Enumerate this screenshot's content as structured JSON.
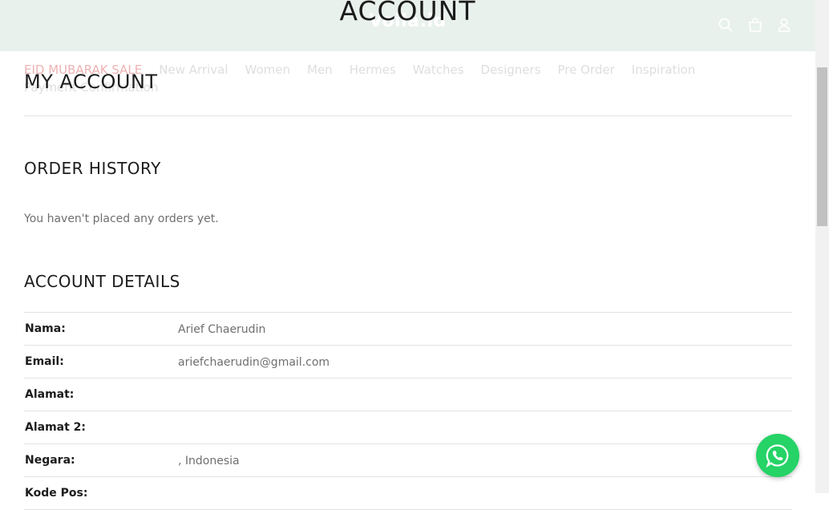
{
  "header": {
    "logo": "Voila.id",
    "page_heading": "ACCOUNT",
    "icons": [
      "search-icon",
      "cart-icon",
      "user-icon"
    ]
  },
  "nav": {
    "items": [
      "EID MUBARAK SALE",
      "New Arrival",
      "Women",
      "Men",
      "Hermes",
      "Watches",
      "Designers",
      "Pre Order",
      "Inspiration"
    ],
    "items_row2": [
      "Payment Confirmation"
    ]
  },
  "main": {
    "title": "MY ACCOUNT",
    "order_history": {
      "heading": "ORDER HISTORY",
      "empty_text": "You haven't placed any orders yet."
    },
    "account_details": {
      "heading": "ACCOUNT DETAILS",
      "rows": [
        {
          "label": "Nama:",
          "value": "Arief Chaerudin"
        },
        {
          "label": "Email:",
          "value": "ariefchaerudin@gmail.com"
        },
        {
          "label": "Alamat:",
          "value": ""
        },
        {
          "label": "Alamat 2:",
          "value": ""
        },
        {
          "label": "Negara:",
          "value": ", Indonesia"
        },
        {
          "label": "Kode Pos:",
          "value": ""
        }
      ]
    }
  },
  "colors": {
    "header_bg": "#e9f1ed",
    "sale": "#e47f7f",
    "whatsapp": "#25d366"
  },
  "floating": {
    "whatsapp_icon": "whatsapp-icon"
  }
}
